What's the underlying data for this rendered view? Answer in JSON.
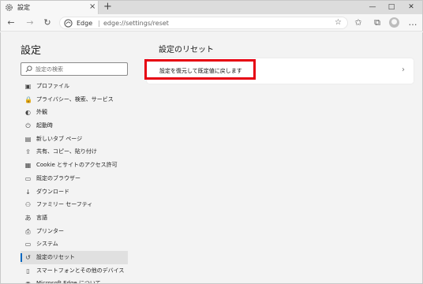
{
  "tab": {
    "title": "設定",
    "close": "×",
    "new_tab": "+"
  },
  "window": {
    "minimize": "—",
    "maximize": "□",
    "close": "✕"
  },
  "omnibox": {
    "brand": "Edge",
    "separator": "|",
    "url": "edge://settings/reset"
  },
  "sidebar": {
    "title": "設定",
    "search_placeholder": "設定の検索",
    "items": [
      {
        "label": "プロファイル",
        "icon": "profile-icon",
        "glyph": "▣"
      },
      {
        "label": "プライバシー、検索、サービス",
        "icon": "lock-icon",
        "glyph": "🔒"
      },
      {
        "label": "外観",
        "icon": "appearance-icon",
        "glyph": "◐"
      },
      {
        "label": "起動時",
        "icon": "power-icon",
        "glyph": "⏻"
      },
      {
        "label": "新しいタブ ページ",
        "icon": "newtab-icon",
        "glyph": "▤"
      },
      {
        "label": "共有、コピー、貼り付け",
        "icon": "share-icon",
        "glyph": "⇪"
      },
      {
        "label": "Cookie とサイトのアクセス許可",
        "icon": "cookie-icon",
        "glyph": "▦"
      },
      {
        "label": "既定のブラウザー",
        "icon": "browser-icon",
        "glyph": "▭"
      },
      {
        "label": "ダウンロード",
        "icon": "download-icon",
        "glyph": "↓"
      },
      {
        "label": "ファミリー セーフティ",
        "icon": "family-icon",
        "glyph": "⚇"
      },
      {
        "label": "言語",
        "icon": "language-icon",
        "glyph": "あ"
      },
      {
        "label": "プリンター",
        "icon": "printer-icon",
        "glyph": "⎙"
      },
      {
        "label": "システム",
        "icon": "system-icon",
        "glyph": "▭"
      },
      {
        "label": "設定のリセット",
        "icon": "reset-icon",
        "glyph": "↺"
      },
      {
        "label": "スマートフォンとその他のデバイス",
        "icon": "phone-icon",
        "glyph": "▯"
      },
      {
        "label": "Microsoft Edge について",
        "icon": "edge-icon",
        "glyph": "◉"
      }
    ],
    "active_index": 13
  },
  "main": {
    "title": "設定のリセット",
    "reset_item_label": "設定を復元して既定値に戻します",
    "chevron": "›"
  },
  "colors": {
    "accent": "#0067c0",
    "highlight": "#e60012"
  }
}
